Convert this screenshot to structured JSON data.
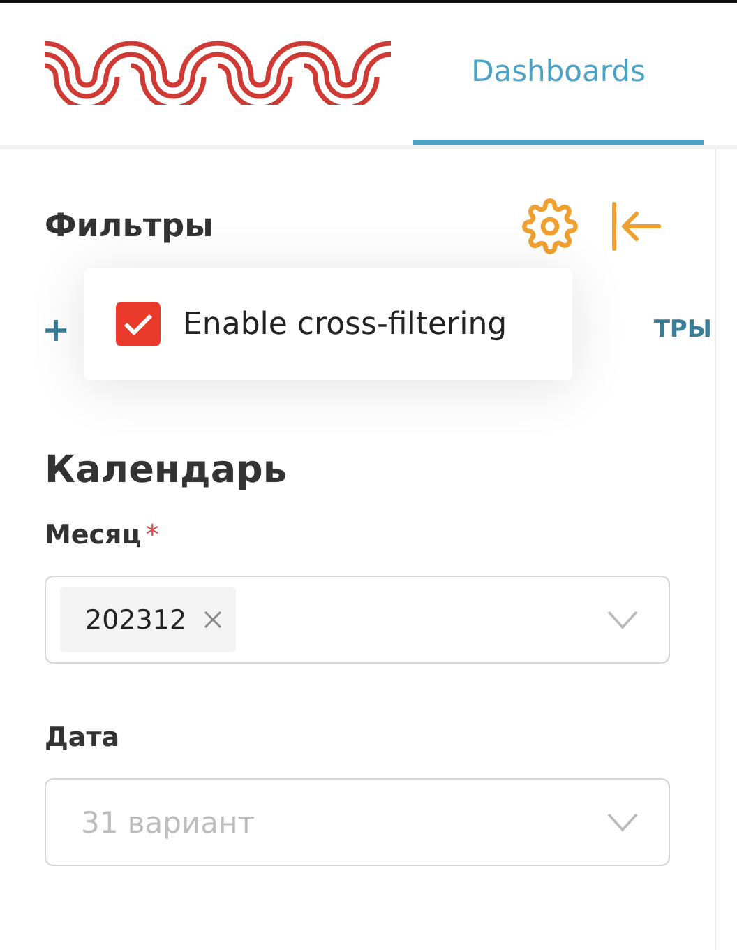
{
  "header": {
    "tabs": [
      {
        "label": "Dashboards",
        "selected": true
      }
    ]
  },
  "filters": {
    "title": "Фильтры",
    "add_label": "+",
    "action_label": "ТРЫ",
    "popover": {
      "label": "Enable cross-filtering",
      "checked": true
    },
    "section": "Календарь",
    "fields": [
      {
        "label": "Месяц",
        "required_mark": "*",
        "tags": [
          "202312"
        ]
      },
      {
        "label": "Дата",
        "placeholder": "31 вариант"
      }
    ]
  }
}
